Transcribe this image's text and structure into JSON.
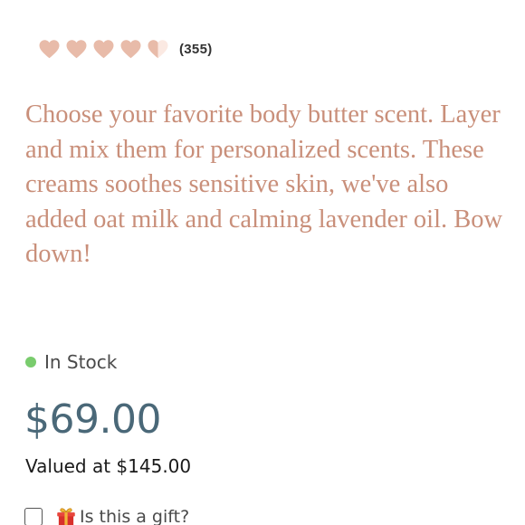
{
  "rating": {
    "value": 4.5,
    "max": 5,
    "filled_color": "#e8bba9",
    "empty_color": "#fbe9e2",
    "review_count": "(355)"
  },
  "description": "Choose your favorite body butter scent. Layer and mix them for personalized scents. These creams soothes sensitive skin, we've also added oat milk and calming lavender oil. Bow down!",
  "stock": {
    "label": "In Stock",
    "indicator_color": "#79cc6d"
  },
  "price": {
    "current": "$69.00",
    "valued_at": "Valued at $145.00",
    "color": "#4a6878"
  },
  "gift": {
    "icon": "gift-icon",
    "label": "Is this a gift?",
    "checked": false
  }
}
